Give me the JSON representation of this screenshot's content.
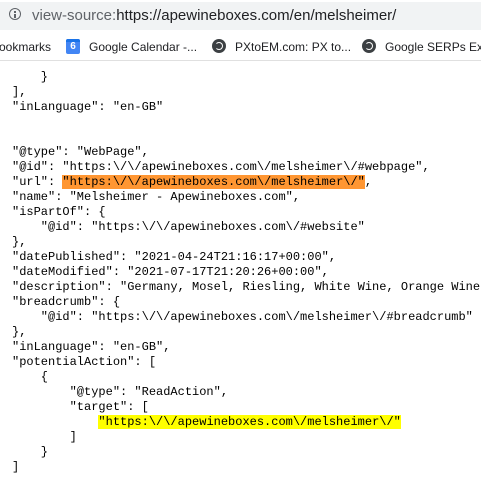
{
  "browser": {
    "url_scheme": "view-source:",
    "url_rest": "https://apewineboxes.com/en/melsheimer/"
  },
  "bookmarks_bar": {
    "items": [
      {
        "label": "ookmarks",
        "icon": "none"
      },
      {
        "label": "Google Calendar -...",
        "icon": "google-calendar-icon",
        "badge": "6"
      },
      {
        "label": "PXtoEM.com: PX to...",
        "icon": "globe-icon"
      },
      {
        "label": "Google SERPs Extr",
        "icon": "globe-icon"
      }
    ]
  },
  "source": {
    "lines": [
      "    }",
      "],",
      "\"inLanguage\": \"en-GB\"",
      "",
      "",
      "\"@type\": \"WebPage\",",
      "\"@id\": \"https:\\/\\/apewineboxes.com\\/melsheimer\\/#webpage\",",
      "\"url\": ",
      "\"name\": \"Melsheimer - Apewineboxes.com\",",
      "\"isPartOf\": {",
      "    \"@id\": \"https:\\/\\/apewineboxes.com\\/#website\"",
      "},",
      "\"datePublished\": \"2021-04-24T21:16:17+00:00\",",
      "\"dateModified\": \"2021-07-17T21:20:26+00:00\",",
      "\"description\": \"Germany, Mosel, Riesling, White Wine, Orange Wine,",
      "\"breadcrumb\": {",
      "    \"@id\": \"https:\\/\\/apewineboxes.com\\/melsheimer\\/#breadcrumb\"",
      "},",
      "\"inLanguage\": \"en-GB\",",
      "\"potentialAction\": [",
      "    {",
      "        \"@type\": \"ReadAction\",",
      "        \"target\": [",
      "            ",
      "        ]",
      "    }",
      "]"
    ],
    "url_highlight": "\"https:\\/\\/apewineboxes.com\\/melsheimer\\/\"",
    "url_suffix": ",",
    "target_highlight": "\"https:\\/\\/apewineboxes.com\\/melsheimer\\/\"",
    "highlight_colors": {
      "active_match": "#ff9632",
      "match": "#ffff00"
    }
  }
}
